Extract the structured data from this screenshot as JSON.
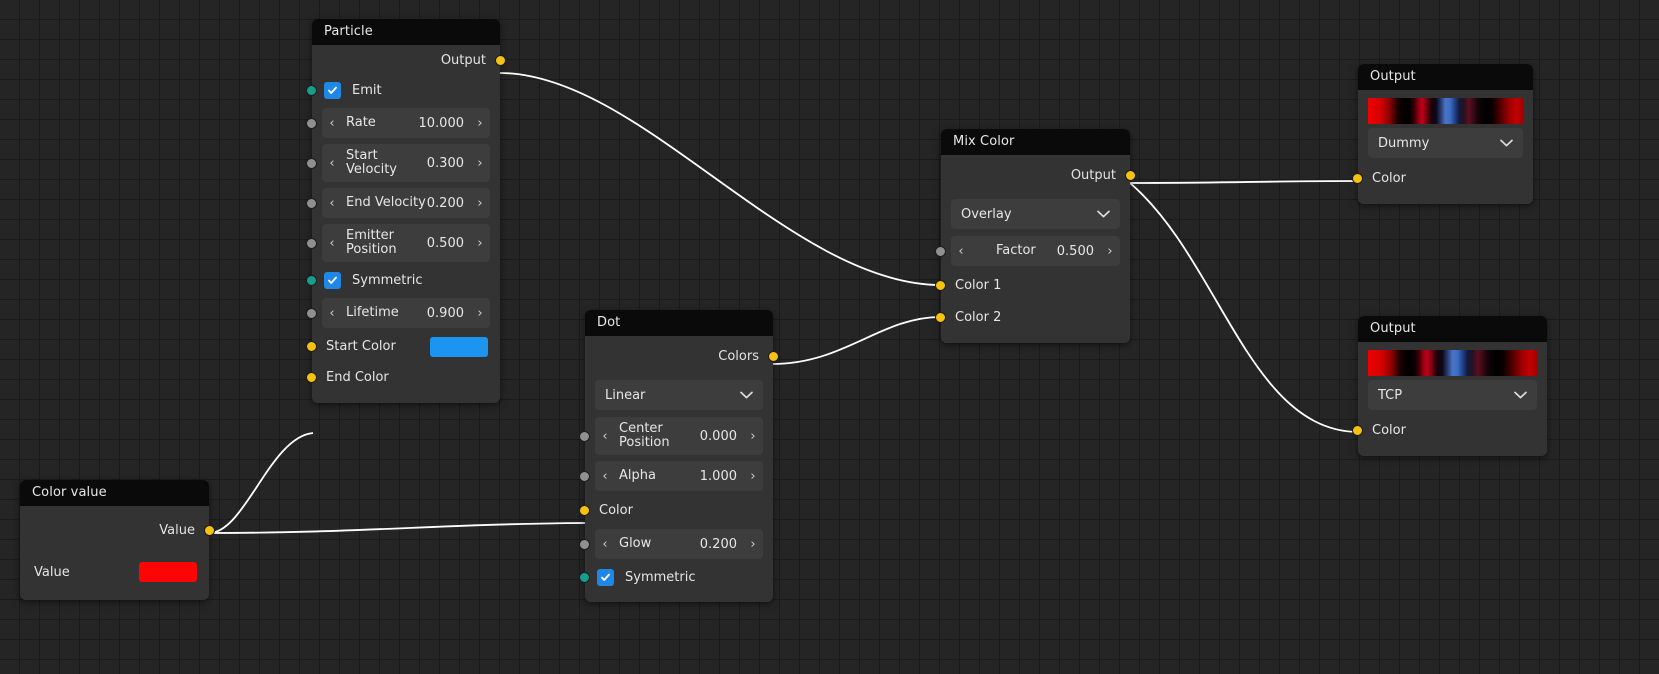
{
  "canvas": {
    "background": "#252525",
    "grid_color": "#1b1b1b",
    "grid_size": 20
  },
  "colors": {
    "socket_color": "#f5c211",
    "socket_value": "#909090",
    "socket_bool": "#159e8d",
    "checkbox": "#1f87e6",
    "node_body": "#333333",
    "node_header": "#0a0a0a",
    "field": "#3d3d3d",
    "wire": "#ffffff",
    "start_color_swatch": "#1b95f0",
    "value_swatch": "#fb0505"
  },
  "nodes": [
    {
      "id": "particle",
      "title": "Particle",
      "outputs": [
        {
          "label": "Output",
          "socket": "yellow"
        }
      ],
      "rows": [
        {
          "type": "checkbox",
          "label": "Emit",
          "checked": true,
          "socket": "teal"
        },
        {
          "type": "field",
          "label": "Rate",
          "value": "10.000",
          "socket": "grey"
        },
        {
          "type": "field",
          "label": "Start Velocity",
          "value": "0.300",
          "socket": "grey",
          "tall": true
        },
        {
          "type": "field",
          "label": "End Velocity",
          "value": "0.200",
          "socket": "grey"
        },
        {
          "type": "field",
          "label": "Emitter Position",
          "value": "0.500",
          "socket": "grey",
          "tall": true
        },
        {
          "type": "checkbox",
          "label": "Symmetric",
          "checked": true,
          "socket": "teal"
        },
        {
          "type": "field",
          "label": "Lifetime",
          "value": "0.900",
          "socket": "grey"
        },
        {
          "type": "swatch",
          "label": "Start Color",
          "color": "#1b95f0",
          "socket": "yellow"
        },
        {
          "type": "label",
          "label": "End Color",
          "socket": "yellow"
        }
      ]
    },
    {
      "id": "dot",
      "title": "Dot",
      "outputs": [
        {
          "label": "Colors",
          "socket": "yellow"
        }
      ],
      "rows": [
        {
          "type": "dropdown",
          "value": "Linear"
        },
        {
          "type": "field",
          "label": "Center Position",
          "value": "0.000",
          "socket": "grey",
          "tall": true
        },
        {
          "type": "field",
          "label": "Alpha",
          "value": "1.000",
          "socket": "grey"
        },
        {
          "type": "label",
          "label": "Color",
          "socket": "yellow"
        },
        {
          "type": "field",
          "label": "Glow",
          "value": "0.200",
          "socket": "grey"
        },
        {
          "type": "checkbox",
          "label": "Symmetric",
          "checked": true,
          "socket": "teal"
        }
      ]
    },
    {
      "id": "mixcolor",
      "title": "Mix Color",
      "outputs": [
        {
          "label": "Output",
          "socket": "yellow"
        }
      ],
      "rows": [
        {
          "type": "dropdown",
          "value": "Overlay"
        },
        {
          "type": "field",
          "label": "Factor",
          "value": "0.500",
          "socket": "grey"
        },
        {
          "type": "label",
          "label": "Color 1",
          "socket": "yellow"
        },
        {
          "type": "label",
          "label": "Color 2",
          "socket": "yellow"
        }
      ]
    },
    {
      "id": "output-dummy",
      "title": "Output",
      "outputs": [],
      "rows": [
        {
          "type": "gradient",
          "name": "color-ramp-preview"
        },
        {
          "type": "dropdown",
          "value": "Dummy"
        },
        {
          "type": "label",
          "label": "Color",
          "socket": "yellow"
        }
      ]
    },
    {
      "id": "output-tcp",
      "title": "Output",
      "outputs": [],
      "rows": [
        {
          "type": "gradient",
          "name": "color-ramp-preview"
        },
        {
          "type": "dropdown",
          "value": "TCP"
        },
        {
          "type": "label",
          "label": "Color",
          "socket": "yellow"
        }
      ]
    },
    {
      "id": "colorvalue",
      "title": "Color value",
      "outputs": [
        {
          "label": "Value",
          "socket": "yellow"
        }
      ],
      "rows": [
        {
          "type": "swatch",
          "label": "Value",
          "color": "#fb0505"
        }
      ]
    }
  ],
  "glyphs": {
    "arrow_left": "‹",
    "arrow_right": "›",
    "chevron_down": "⌄",
    "check": "✓"
  }
}
